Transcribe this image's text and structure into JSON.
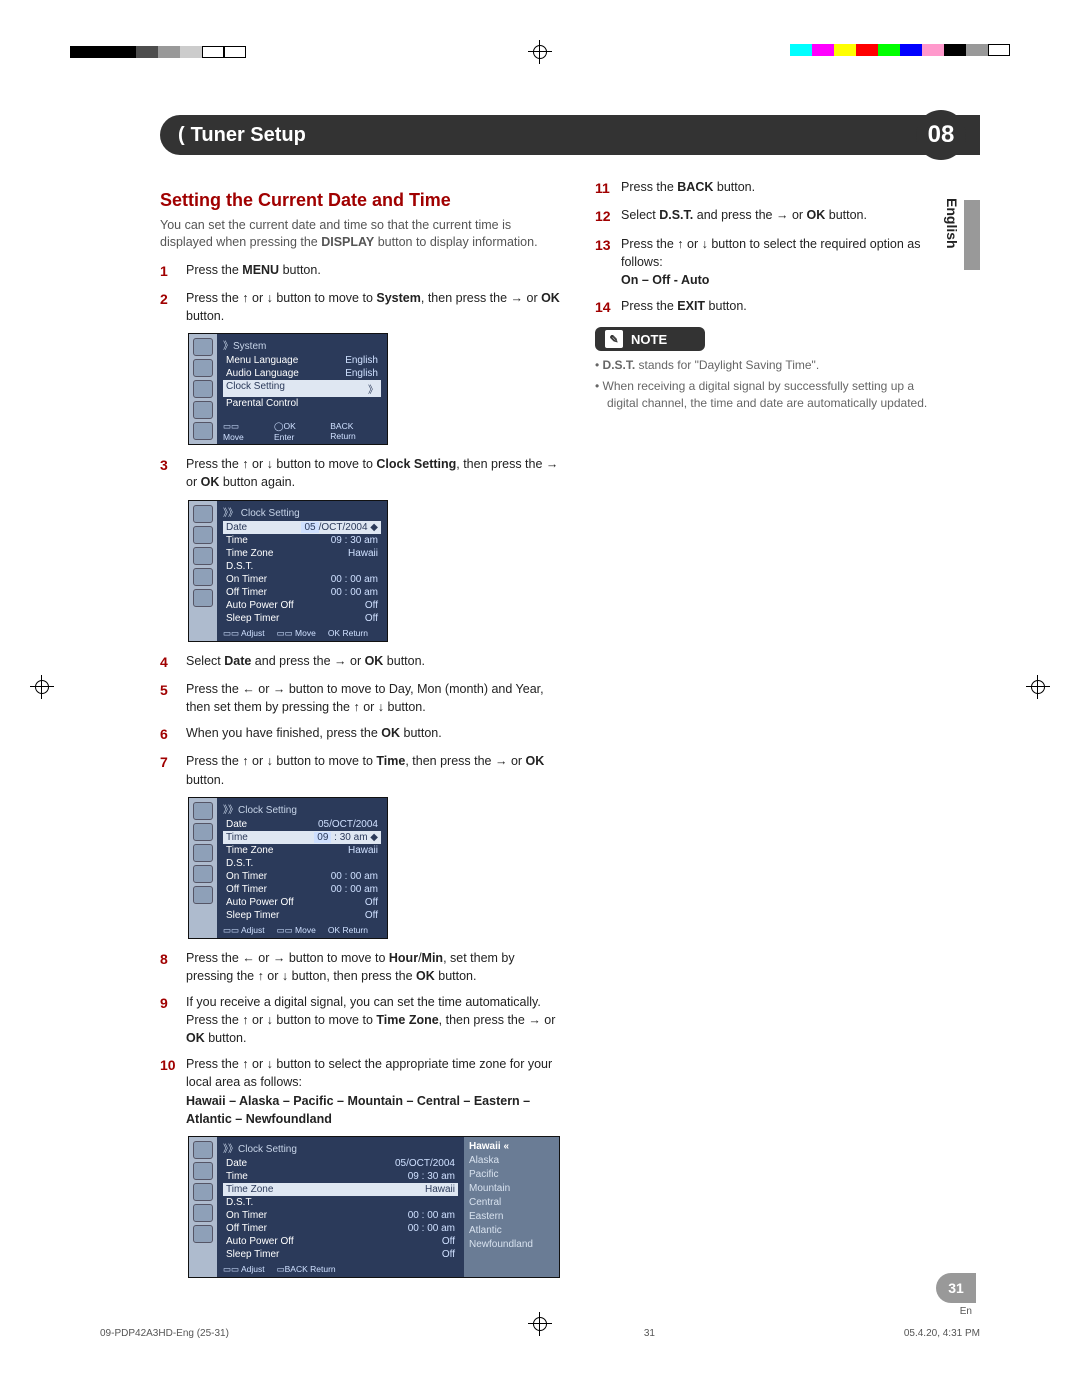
{
  "chapter": {
    "title": "Tuner Setup",
    "number": "08"
  },
  "sidebar_lang": "English",
  "page_number": "31",
  "page_lang_abbrev": "En",
  "footer": {
    "filename": "09-PDP42A3HD-Eng (25-31)",
    "page": "31",
    "timestamp": "05.4.20, 4:31 PM"
  },
  "section_heading": "Setting the Current Date and Time",
  "section_intro_a": "You can set the current date and time so that the current time is displayed when pressing the ",
  "section_intro_b": "DISPLAY",
  "section_intro_c": " button to display information.",
  "steps_left": [
    {
      "n": "1",
      "parts": [
        "Press the ",
        {
          "b": "MENU"
        },
        " button."
      ]
    },
    {
      "n": "2",
      "parts": [
        "Press the ",
        {
          "s": "↑"
        },
        " or ",
        {
          "s": "↓"
        },
        " button to move to ",
        {
          "b": "System"
        },
        ", then press the ",
        {
          "s": "→"
        },
        " or ",
        {
          "b": "OK"
        },
        " button."
      ]
    },
    {
      "n": "3",
      "parts": [
        "Press the ",
        {
          "s": "↑"
        },
        " or ",
        {
          "s": "↓"
        },
        " button to move to ",
        {
          "b": "Clock Setting"
        },
        ", then press the ",
        {
          "s": "→"
        },
        " or ",
        {
          "b": "OK"
        },
        " button again."
      ]
    },
    {
      "n": "4",
      "parts": [
        "Select ",
        {
          "b": "Date"
        },
        " and press the ",
        {
          "s": "→"
        },
        " or ",
        {
          "b": "OK"
        },
        " button."
      ]
    },
    {
      "n": "5",
      "parts": [
        "Press the ",
        {
          "s": "←"
        },
        " or ",
        {
          "s": "→"
        },
        " button to move to Day, Mon (month) and Year, then set them by pressing the ",
        {
          "s": "↑"
        },
        " or ",
        {
          "s": "↓"
        },
        " button."
      ]
    },
    {
      "n": "6",
      "parts": [
        "When you have finished, press the ",
        {
          "b": "OK"
        },
        " button."
      ]
    },
    {
      "n": "7",
      "parts": [
        "Press the ",
        {
          "s": "↑"
        },
        " or ",
        {
          "s": "↓"
        },
        " button to move to ",
        {
          "b": "Time"
        },
        ", then press the ",
        {
          "s": "→"
        },
        " or ",
        {
          "b": "OK"
        },
        " button."
      ]
    },
    {
      "n": "8",
      "parts": [
        "Press the ",
        {
          "s": "←"
        },
        " or ",
        {
          "s": "→"
        },
        " button to move to ",
        {
          "b": "Hour"
        },
        "/",
        {
          "b": "Min"
        },
        ", set them by pressing the ",
        {
          "s": "↑"
        },
        " or ",
        {
          "s": "↓"
        },
        " button, then press the ",
        {
          "b": "OK"
        },
        " button."
      ]
    },
    {
      "n": "9",
      "parts": [
        "If you receive a digital signal, you can set the time automatically. Press the ",
        {
          "s": "↑"
        },
        " or ",
        {
          "s": "↓"
        },
        " button to move to ",
        {
          "b": "Time Zone"
        },
        ", then press the ",
        {
          "s": "→"
        },
        " or ",
        {
          "b": "OK"
        },
        " button."
      ]
    },
    {
      "n": "10",
      "parts": [
        "Press the ",
        {
          "s": "↑"
        },
        " or ",
        {
          "s": "↓"
        },
        " button to select the appropriate time zone for your local area as follows:"
      ],
      "tail_b": "Hawaii – Alaska – Pacific – Mountain – Central – Eastern – Atlantic – Newfoundland"
    }
  ],
  "steps_right": [
    {
      "n": "11",
      "parts": [
        "Press the ",
        {
          "b": "BACK"
        },
        " button."
      ]
    },
    {
      "n": "12",
      "parts": [
        "Select ",
        {
          "b": "D.S.T."
        },
        " and press the ",
        {
          "s": "→"
        },
        " or ",
        {
          "b": "OK"
        },
        " button."
      ]
    },
    {
      "n": "13",
      "parts": [
        "Press the ",
        {
          "s": "↑"
        },
        " or ",
        {
          "s": "↓"
        },
        " button to select the required option as follows:"
      ],
      "tail_b": "On – Off - Auto"
    },
    {
      "n": "14",
      "parts": [
        "Press the ",
        {
          "b": "EXIT"
        },
        " button."
      ]
    }
  ],
  "note_label": "NOTE",
  "notes": [
    {
      "pre": "",
      "b": "D.S.T.",
      "post": " stands for \"Daylight Saving Time\"."
    },
    {
      "pre": "When receiving a digital signal by successfully setting up a digital channel, the time and date are automatically updated.",
      "b": "",
      "post": ""
    }
  ],
  "osd1": {
    "header": "》System",
    "rows": [
      {
        "l": "Menu Language",
        "v": "English"
      },
      {
        "l": "Audio Language",
        "v": "English"
      },
      {
        "l": "Clock Setting",
        "v": "》",
        "sel": true
      },
      {
        "l": "Parental Control",
        "v": ""
      }
    ],
    "footer": [
      "▭▭ Move",
      "◯OK Enter",
      "BACK Return"
    ]
  },
  "osd2": {
    "header": "》》  Clock Setting",
    "rows": [
      {
        "l": "Date",
        "v": "05/OCT/2004",
        "valbox": "05",
        "sel": true
      },
      {
        "l": "Time",
        "v": "09 : 30 am"
      },
      {
        "l": "Time Zone",
        "v": "Hawaii"
      },
      {
        "l": "D.S.T.",
        "v": ""
      },
      {
        "l": "On Timer",
        "v": "00 : 00 am"
      },
      {
        "l": "Off Timer",
        "v": "00 : 00 am"
      },
      {
        "l": "Auto Power Off",
        "v": "Off"
      },
      {
        "l": "Sleep Timer",
        "v": "Off"
      }
    ],
    "footer": [
      "▭▭ Adjust",
      "▭▭ Move",
      "OK Return"
    ]
  },
  "osd3": {
    "header": "》》Clock Setting",
    "rows": [
      {
        "l": "Date",
        "v": "05/OCT/2004"
      },
      {
        "l": "Time",
        "v": "09 : 30 am",
        "valbox": "09",
        "sel": true
      },
      {
        "l": "Time Zone",
        "v": "Hawaii"
      },
      {
        "l": "D.S.T.",
        "v": ""
      },
      {
        "l": "On Timer",
        "v": "00 : 00 am"
      },
      {
        "l": "Off Timer",
        "v": "00 : 00 am"
      },
      {
        "l": "Auto Power Off",
        "v": "Off"
      },
      {
        "l": "Sleep Timer",
        "v": "Off"
      }
    ],
    "footer": [
      "▭▭ Adjust",
      "▭▭ Move",
      "OK Return"
    ]
  },
  "osd4": {
    "header": "》》Clock Setting",
    "rows": [
      {
        "l": "Date",
        "v": "05/OCT/2004"
      },
      {
        "l": "Time",
        "v": "09 : 30 am"
      },
      {
        "l": "Time Zone",
        "v": "Hawaii",
        "sel": true
      },
      {
        "l": "D.S.T.",
        "v": ""
      },
      {
        "l": "On Timer",
        "v": "00 : 00 am"
      },
      {
        "l": "Off Timer",
        "v": "00 : 00 am"
      },
      {
        "l": "Auto Power Off",
        "v": "Off"
      },
      {
        "l": "Sleep Timer",
        "v": "Off"
      }
    ],
    "footer": [
      "▭▭ Adjust",
      "▭BACK Return"
    ],
    "popup": [
      "Hawaii",
      "Alaska",
      "Pacific",
      "Mountain",
      "Central",
      "Eastern",
      "Atlantic",
      "Newfoundland"
    ],
    "popup_sel": 0
  }
}
